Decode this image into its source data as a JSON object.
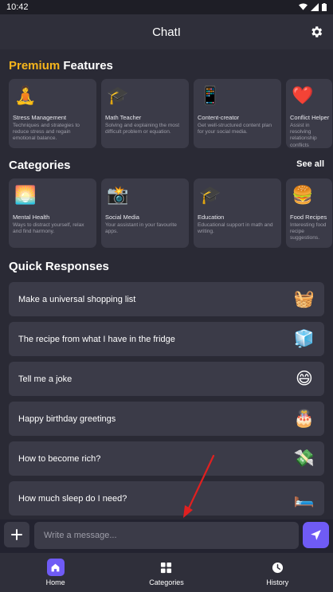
{
  "status": {
    "time": "10:42"
  },
  "header": {
    "title": "ChatI"
  },
  "premium": {
    "title_accent": "Premium",
    "title_rest": " Features",
    "cards": [
      {
        "title": "Stress Management",
        "desc": "Techniques and strategies to reduce stress and regain emotional balance.",
        "icon": "meditation-icon",
        "emoji": "🧘"
      },
      {
        "title": "Math Teacher",
        "desc": "Solving and explaining the most difficult problem or equation.",
        "icon": "graduation-cap-icon",
        "emoji": "🎓"
      },
      {
        "title": "Content-creator",
        "desc": "Get well-structured content plan for your social media.",
        "icon": "phone-icon",
        "emoji": "📱"
      },
      {
        "title": "Conflict Helper",
        "desc": "Assist in resolving relationship conflicts peacefully.",
        "icon": "heart-icon",
        "emoji": "❤️"
      }
    ]
  },
  "categories": {
    "title": "Categories",
    "see_all": "See all",
    "cards": [
      {
        "title": "Mental Health",
        "desc": "Ways to distract yourself, relax and find harmony.",
        "icon": "mental-health-icon",
        "emoji": "🌅"
      },
      {
        "title": "Social Media",
        "desc": "Your assistant in your favourite apps.",
        "icon": "social-media-icon",
        "emoji": "📸"
      },
      {
        "title": "Education",
        "desc": "Educational support in math and writing.",
        "icon": "graduation-cap-icon",
        "emoji": "🎓"
      },
      {
        "title": "Food Recipes",
        "desc": "Interesting food recipe suggestions.",
        "icon": "burger-icon",
        "emoji": "🍔"
      }
    ]
  },
  "quick": {
    "title": "Quick Responses",
    "items": [
      {
        "text": "Make a universal shopping list",
        "icon": "basket-icon",
        "emoji": "🧺"
      },
      {
        "text": "The recipe from what I have in the fridge",
        "icon": "fridge-icon",
        "emoji": "🧊"
      },
      {
        "text": "Tell me a joke",
        "icon": "smile-icon",
        "emoji": "😄"
      },
      {
        "text": "Happy birthday greetings",
        "icon": "cake-icon",
        "emoji": "🎂"
      },
      {
        "text": "How to become rich?",
        "icon": "money-icon",
        "emoji": "💸"
      },
      {
        "text": "How much sleep do I need?",
        "icon": "bed-icon",
        "emoji": "🛏️"
      }
    ]
  },
  "composer": {
    "placeholder": "Write a message..."
  },
  "nav": {
    "items": [
      {
        "label": "Home",
        "icon": "home-icon"
      },
      {
        "label": "Categories",
        "icon": "grid-icon"
      },
      {
        "label": "History",
        "icon": "clock-icon"
      }
    ]
  },
  "colors": {
    "accent": "#f5b51c",
    "primary": "#6f5bf5",
    "bg": "#2a2a35",
    "card": "#3b3b48",
    "annotation": "#e02020"
  }
}
